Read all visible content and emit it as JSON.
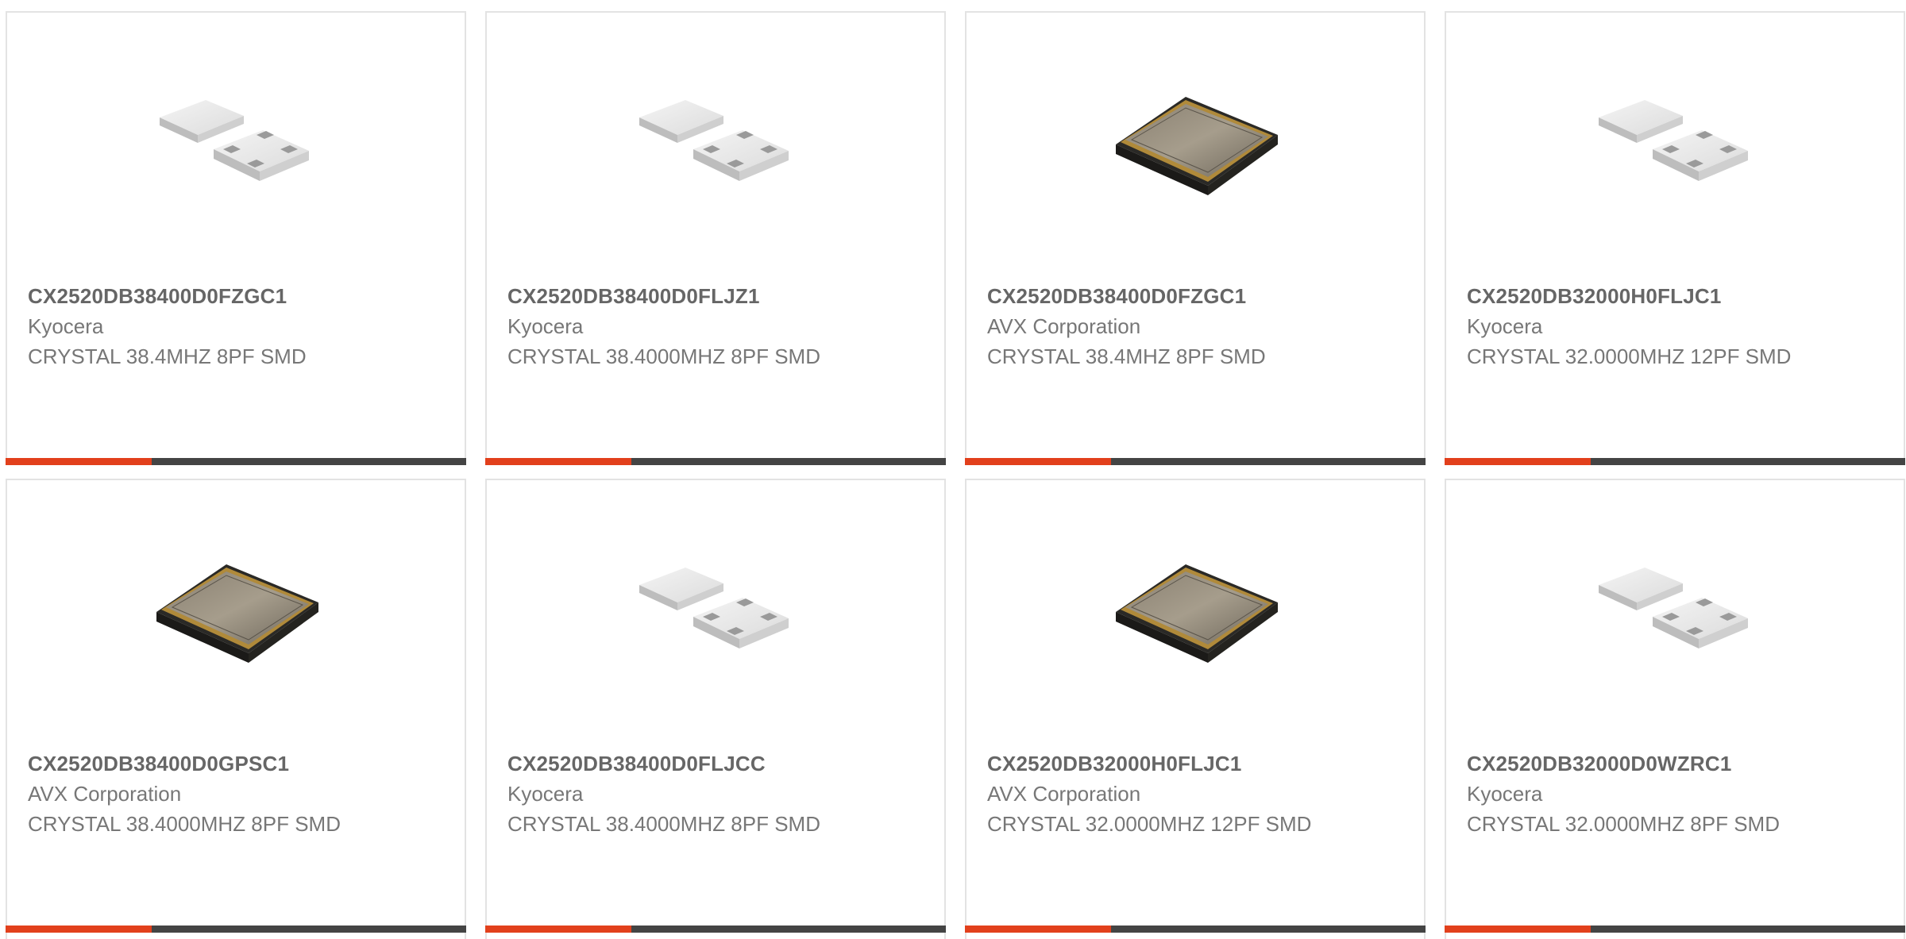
{
  "products": [
    {
      "part_number": "CX2520DB38400D0FZGC1",
      "manufacturer": "Kyocera",
      "description": "CRYSTAL 38.4MHZ 8PF SMD",
      "image_type": "white-package-crystal-image"
    },
    {
      "part_number": "CX2520DB38400D0FLJZ1",
      "manufacturer": "Kyocera",
      "description": "CRYSTAL 38.4000MHZ 8PF SMD",
      "image_type": "white-package-crystal-image"
    },
    {
      "part_number": "CX2520DB38400D0FZGC1",
      "manufacturer": "AVX Corporation",
      "description": "CRYSTAL 38.4MHZ 8PF SMD",
      "image_type": "metal-can-crystal-image"
    },
    {
      "part_number": "CX2520DB32000H0FLJC1",
      "manufacturer": "Kyocera",
      "description": "CRYSTAL 32.0000MHZ 12PF SMD",
      "image_type": "white-package-crystal-image"
    },
    {
      "part_number": "CX2520DB38400D0GPSC1",
      "manufacturer": "AVX Corporation",
      "description": "CRYSTAL 38.4000MHZ 8PF SMD",
      "image_type": "metal-can-crystal-image"
    },
    {
      "part_number": "CX2520DB38400D0FLJCC",
      "manufacturer": "Kyocera",
      "description": "CRYSTAL 38.4000MHZ 8PF SMD",
      "image_type": "white-package-crystal-image"
    },
    {
      "part_number": "CX2520DB32000H0FLJC1",
      "manufacturer": "AVX Corporation",
      "description": "CRYSTAL 32.0000MHZ 12PF SMD",
      "image_type": "metal-can-crystal-image"
    },
    {
      "part_number": "CX2520DB32000D0WZRC1",
      "manufacturer": "Kyocera",
      "description": "CRYSTAL 32.0000MHZ 8PF SMD",
      "image_type": "white-package-crystal-image"
    }
  ],
  "colors": {
    "accent": "#e2401c",
    "bar_dark": "#444444",
    "part_number_text": "#666666",
    "body_text": "#777777",
    "card_border": "#e3e3e3"
  }
}
